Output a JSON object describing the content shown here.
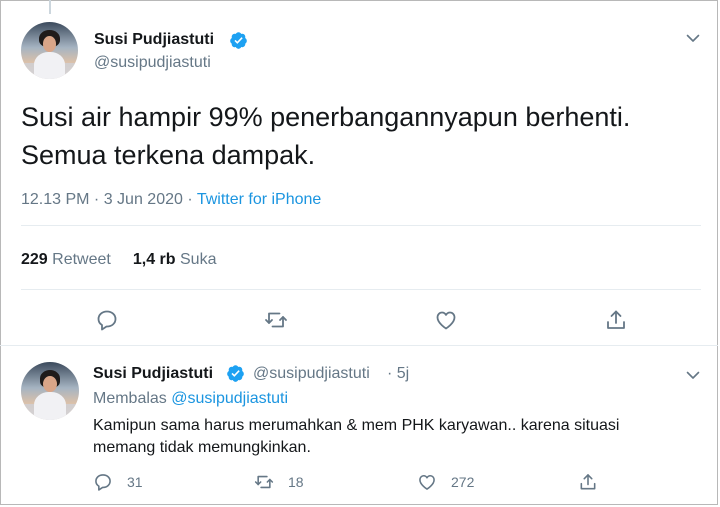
{
  "main_tweet": {
    "author_name": "Susi Pudjiastuti",
    "author_handle": "@susipudjiastuti",
    "text": "Susi air hampir 99% penerbangannyapun berhenti.\nSemua terkena dampak.",
    "timestamp": "12.13 PM · 3 Jun 2020 · ",
    "source": "Twitter for iPhone",
    "retweet_count": "229",
    "retweet_label": "Retweet",
    "like_count": "1,4 rb",
    "like_label": "Suka"
  },
  "reply_tweet": {
    "author_name": "Susi Pudjiastuti",
    "author_handle": "@susipudjiastuti",
    "age": "· 5j",
    "replying_prefix": "Membalas",
    "replying_to": "@susipudjiastuti",
    "text": "Kamipun sama harus merumahkan & mem PHK karyawan.. karena situasi\nmemang tidak memungkinkan.",
    "reply_count": "31",
    "retweet_count": "18",
    "like_count": "272"
  },
  "icons": {
    "verified": "verified-badge-icon",
    "more": "chevron-down-icon",
    "reply": "reply-icon",
    "retweet": "retweet-icon",
    "like": "heart-icon",
    "share": "share-icon"
  },
  "colors": {
    "link": "#1b95e0",
    "muted": "#657786",
    "text": "#14171a",
    "verified": "#1da1f2"
  }
}
